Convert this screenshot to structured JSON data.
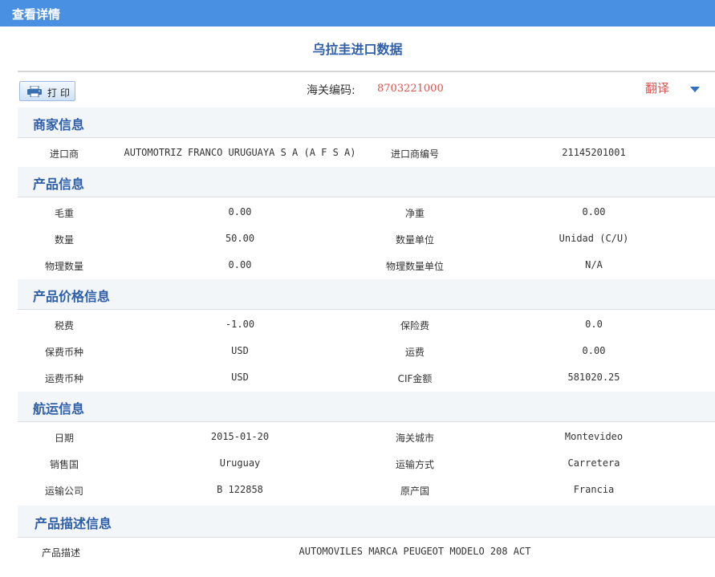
{
  "window": {
    "title": "查看详情"
  },
  "page": {
    "heading": "乌拉圭进口数据"
  },
  "toolbar": {
    "print_label": "打印"
  },
  "customs": {
    "label": "海关编码:",
    "value": "8703221000"
  },
  "translate": {
    "label": "翻译"
  },
  "sections": {
    "merchant": {
      "title": "商家信息",
      "rows": [
        {
          "l1": "进口商",
          "v1": "AUTOMOTRIZ FRANCO URUGUAYA S A (A F S A)",
          "l2": "进口商编号",
          "v2": "21145201001"
        }
      ]
    },
    "product": {
      "title": "产品信息",
      "rows": [
        {
          "l1": "毛重",
          "v1": "0.00",
          "l2": "净重",
          "v2": "0.00"
        },
        {
          "l1": "数量",
          "v1": "50.00",
          "l2": "数量单位",
          "v2": "Unidad (C/U)"
        },
        {
          "l1": "物理数量",
          "v1": "0.00",
          "l2": "物理数量单位",
          "v2": "N/A"
        }
      ]
    },
    "price": {
      "title": "产品价格信息",
      "rows": [
        {
          "l1": "税费",
          "v1": "-1.00",
          "l2": "保险费",
          "v2": "0.0"
        },
        {
          "l1": "保费币种",
          "v1": "USD",
          "l2": "运费",
          "v2": "0.00"
        },
        {
          "l1": "运费币种",
          "v1": "USD",
          "l2": "CIF金额",
          "v2": "581020.25"
        }
      ]
    },
    "shipping": {
      "title": "航运信息",
      "rows": [
        {
          "l1": "日期",
          "v1": "2015-01-20",
          "l2": "海关城市",
          "v2": "Montevideo"
        },
        {
          "l1": "销售国",
          "v1": "Uruguay",
          "l2": "运输方式",
          "v2": "Carretera"
        },
        {
          "l1": "运输公司",
          "v1": "B 122858",
          "l2": "原产国",
          "v2": "Francia"
        }
      ]
    },
    "description": {
      "title": "产品描述信息",
      "label": "产品描述",
      "value": "AUTOMOVILES MARCA PEUGEOT MODELO 208 ACT"
    }
  },
  "colors": {
    "titlebar": "#4a90e2",
    "heading": "#2f5fa8",
    "highlight": "#d9534f"
  }
}
